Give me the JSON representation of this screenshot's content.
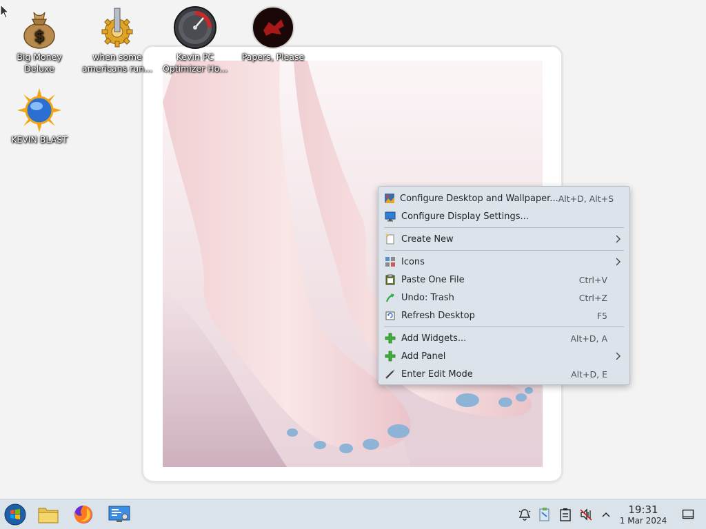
{
  "desktop": {
    "icons": [
      {
        "label": "Big Money Deluxe",
        "icon": "money-bag-icon"
      },
      {
        "label": "when some americans run...",
        "icon": "gear-icon"
      },
      {
        "label": "Kevin PC Optimizer Ho...",
        "icon": "speedometer-icon"
      },
      {
        "label": "Papers, Please",
        "icon": "papers-please-icon"
      },
      {
        "label": "KEVIN BLAST",
        "icon": "sun-globe-icon"
      }
    ]
  },
  "context_menu": {
    "items": [
      {
        "label": "Configure Desktop and Wallpaper...",
        "shortcut": "Alt+D, Alt+S",
        "icon": "desktop-wallpaper-icon"
      },
      {
        "label": "Configure Display Settings...",
        "shortcut": "",
        "icon": "display-settings-icon"
      },
      {
        "label": "Create New",
        "shortcut": "",
        "icon": "new-document-icon",
        "submenu": true
      },
      {
        "label": "Icons",
        "shortcut": "",
        "icon": "icons-grid-icon",
        "submenu": true
      },
      {
        "label": "Paste One File",
        "shortcut": "Ctrl+V",
        "icon": "paste-icon"
      },
      {
        "label": "Undo: Trash",
        "shortcut": "Ctrl+Z",
        "icon": "undo-icon"
      },
      {
        "label": "Refresh Desktop",
        "shortcut": "F5",
        "icon": "refresh-icon"
      },
      {
        "label": "Add Widgets...",
        "shortcut": "Alt+D, A",
        "icon": "add-icon"
      },
      {
        "label": "Add Panel",
        "shortcut": "",
        "icon": "add-icon",
        "submenu": true
      },
      {
        "label": "Enter Edit Mode",
        "shortcut": "Alt+D, E",
        "icon": "edit-brush-icon"
      }
    ]
  },
  "taskbar": {
    "launchers": [
      "start-menu-icon",
      "file-manager-icon",
      "firefox-icon",
      "system-settings-icon"
    ],
    "tray": [
      "notifications-bell-icon",
      "clipboard-icon",
      "task-list-icon",
      "volume-muted-icon",
      "chevron-up-icon"
    ],
    "clock": {
      "time": "19:31",
      "date": "1 Mar 2024"
    }
  },
  "colors": {
    "menu_bg": "#dce3ea",
    "taskbar_bg": "#dbe3ea",
    "desktop_bg": "#f3f3f3",
    "add_green": "#3cb034"
  }
}
